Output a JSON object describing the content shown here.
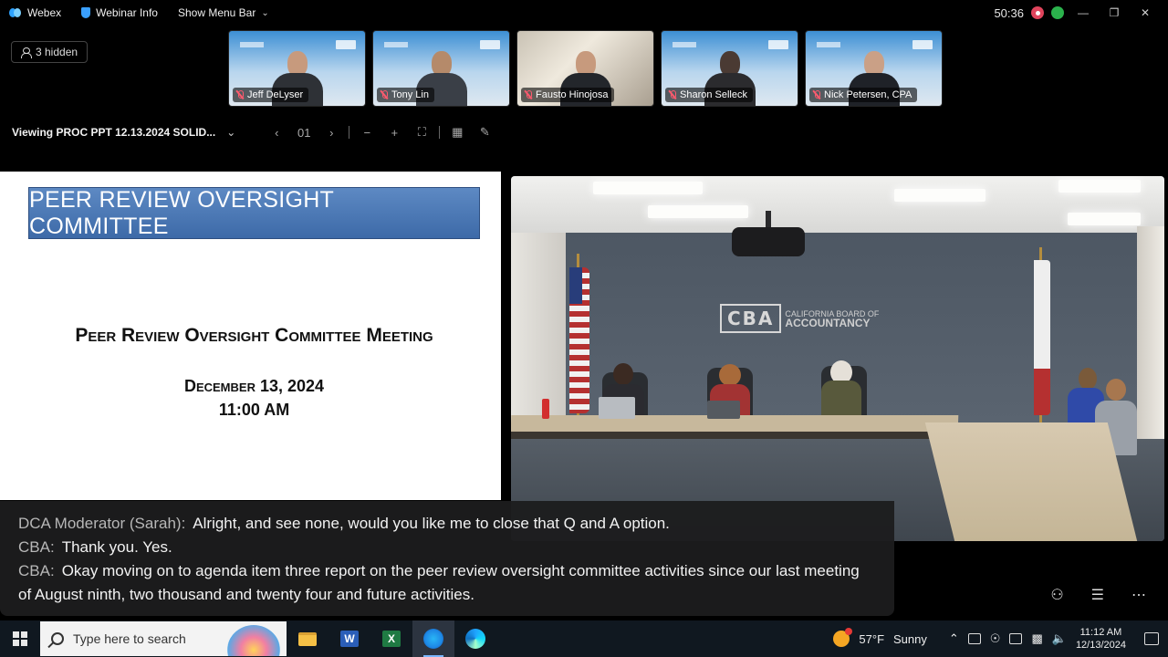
{
  "app": {
    "name": "Webex",
    "menu_webinar_info": "Webinar Info",
    "menu_show_menu_bar": "Show Menu Bar",
    "timer": "50:36"
  },
  "participants": {
    "hidden_label": "3 hidden",
    "thumbnails": [
      {
        "name": "Jeff DeLyser"
      },
      {
        "name": "Tony Lin"
      },
      {
        "name": "Fausto Hinojosa"
      },
      {
        "name": "Sharon Selleck"
      },
      {
        "name": "Nick Petersen, CPA"
      }
    ]
  },
  "viewer": {
    "viewing_label": "Viewing PROC PPT 12.13.2024 SOLID...",
    "page_number": "01"
  },
  "slide": {
    "banner": "PEER REVIEW OVERSIGHT COMMITTEE",
    "title": "Peer Review Oversight Committee Meeting",
    "date": "December 13, 2024",
    "time": "11:00 AM"
  },
  "room": {
    "logo_mark": "CBA",
    "logo_text_1": "CALIFORNIA BOARD OF",
    "logo_text_2": "ACCOUNTANCY"
  },
  "captions": [
    {
      "speaker": "DCA Moderator (Sarah):",
      "text": "Alright, and see none, would you like me to close that Q and A option."
    },
    {
      "speaker": "CBA:",
      "text": "Thank you. Yes."
    },
    {
      "speaker": "CBA:",
      "text": "Okay moving on to agenda item three report on the peer review oversight committee activities since our last meeting of August ninth, two thousand and twenty four and future activities."
    }
  ],
  "taskbar": {
    "search_placeholder": "Type here to search",
    "word_letter": "W",
    "excel_letter": "X",
    "weather_temp": "57°F",
    "weather_desc": "Sunny",
    "time": "11:12 AM",
    "date": "12/13/2024"
  }
}
